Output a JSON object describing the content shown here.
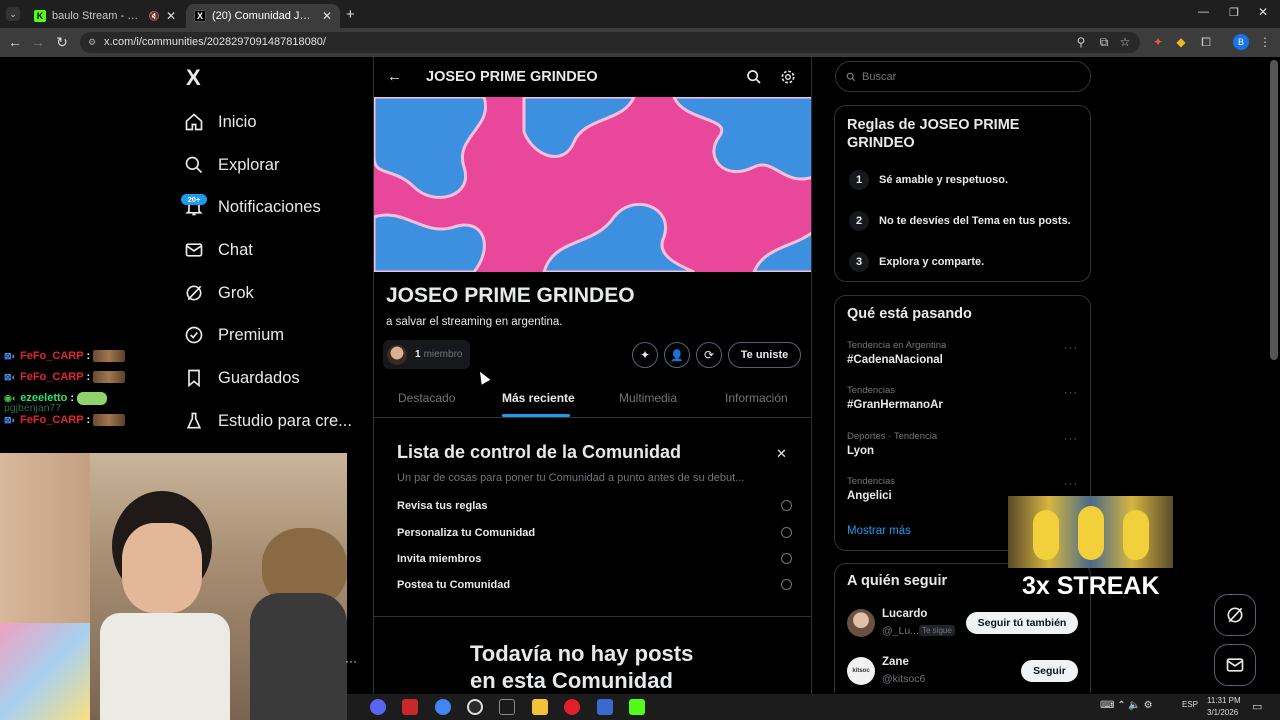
{
  "browser": {
    "tabs": [
      {
        "title": "baulo Stream - Watch Live o",
        "favicon": "K"
      },
      {
        "title": "(20) Comunidad JOSEO PRIME G",
        "favicon": "X"
      }
    ],
    "url": "x.com/i/communities/2028297091487818080/"
  },
  "sidebar": {
    "logo": "X",
    "items": [
      {
        "label": "Inicio",
        "icon": "home-icon"
      },
      {
        "label": "Explorar",
        "icon": "search-icon"
      },
      {
        "label": "Notificaciones",
        "icon": "bell-icon",
        "badge": "20+"
      },
      {
        "label": "Chat",
        "icon": "mail-icon"
      },
      {
        "label": "Grok",
        "icon": "grok-icon"
      },
      {
        "label": "Premium",
        "icon": "verified-icon"
      },
      {
        "label": "Guardados",
        "icon": "bookmark-icon"
      },
      {
        "label": "Estudio para cre...",
        "icon": "studio-icon"
      }
    ],
    "more": "···"
  },
  "chat_overlay": [
    {
      "user": "FeFo_CARP",
      "sep": ":"
    },
    {
      "user": "FeFo_CARP",
      "sep": ":"
    },
    {
      "user": "ezeeletto",
      "sep": ":",
      "under": "pgjbenjan77"
    },
    {
      "user": "FeFo_CARP",
      "sep": ":"
    }
  ],
  "header": {
    "title": "JOSEO PRIME GRINDEO"
  },
  "community": {
    "name": "JOSEO PRIME GRINDEO",
    "description": "a salvar el streaming en argentina.",
    "member_count": "1",
    "member_label": "miembro",
    "joined_button": "Te uniste",
    "banner_colors": [
      "#e8479a",
      "#3d8fe0"
    ]
  },
  "tabs": [
    {
      "label": "Destacado",
      "active": false
    },
    {
      "label": "Más reciente",
      "active": true
    },
    {
      "label": "Multimedia",
      "active": false
    },
    {
      "label": "Información",
      "active": false
    }
  ],
  "checklist": {
    "title": "Lista de control de la Comunidad",
    "subtitle": "Un par de cosas para poner tu Comunidad a punto antes de su debut...",
    "items": [
      "Revisa tus reglas",
      "Personaliza tu Comunidad",
      "Invita miembros",
      "Postea tu Comunidad"
    ]
  },
  "empty": {
    "line1": "Todavía no hay posts",
    "line2": "en esta Comunidad"
  },
  "search": {
    "placeholder": "Buscar"
  },
  "rules": {
    "title": "Reglas de JOSEO PRIME GRINDEO",
    "items": [
      {
        "n": "1",
        "text": "Sé amable y respetuoso."
      },
      {
        "n": "2",
        "text": "No te desvíes del Tema en tus posts."
      },
      {
        "n": "3",
        "text": "Explora y comparte."
      }
    ]
  },
  "trends": {
    "title": "Qué está pasando",
    "items": [
      {
        "category": "Tendencia en Argentina",
        "title": "#CadenaNacional"
      },
      {
        "category": "Tendencias",
        "title": "#GranHermanoAr"
      },
      {
        "category": "Deportes · Tendencia",
        "title": "Lyon"
      },
      {
        "category": "Tendencias",
        "title": "Angelici"
      }
    ],
    "show_more": "Mostrar más"
  },
  "who_to_follow": {
    "title": "A quién seguir",
    "users": [
      {
        "name": "Lucardo",
        "handle": "@_Lu...",
        "badge": "Te sigue",
        "button": "Seguir tú también"
      },
      {
        "name": "Zane",
        "handle": "@kitsoc6",
        "button": "Seguir"
      }
    ]
  },
  "stream_overlay": {
    "streak": "3x STREAK"
  },
  "taskbar": {
    "lang": "ESP",
    "time": "11:31 PM",
    "date": "3/1/2026"
  },
  "colors": {
    "accent": "#1d9bf0",
    "streak": "#ffffff",
    "chat_name": "#e0243a"
  }
}
